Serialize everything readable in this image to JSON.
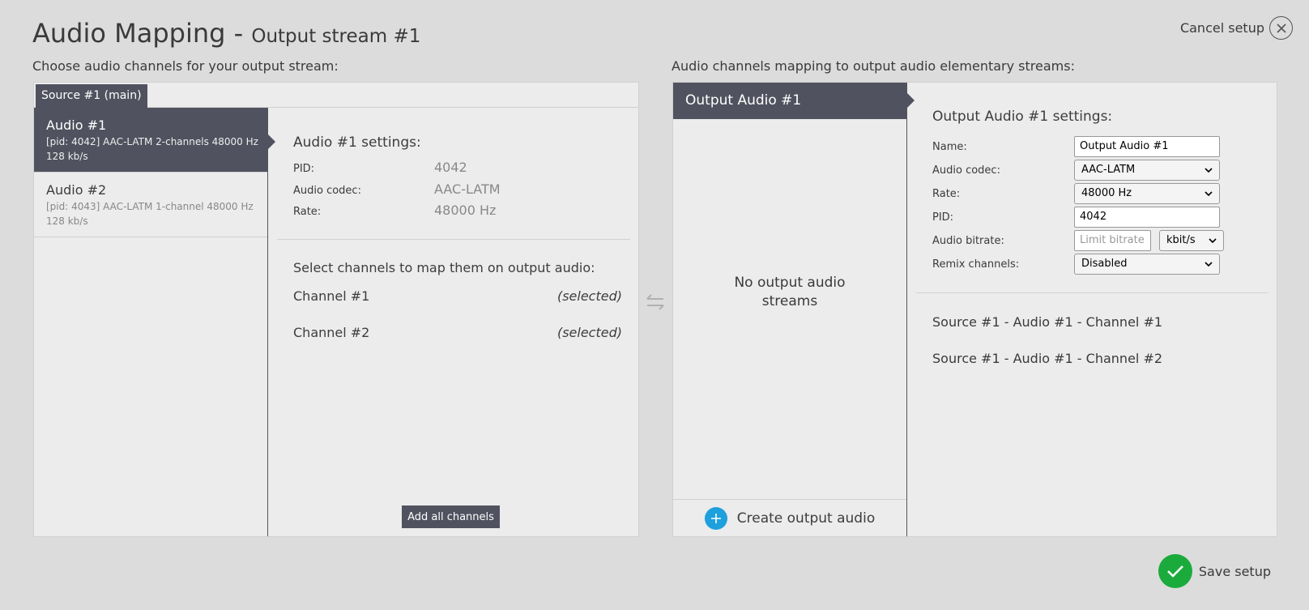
{
  "header": {
    "title": "Audio Mapping -",
    "subtitle": "Output stream #1",
    "cancel_label": "Cancel setup"
  },
  "left": {
    "caption": "Choose audio channels for your output stream:",
    "source_tab": "Source #1 (main)",
    "audio_items": [
      {
        "name": "Audio #1",
        "meta1": "[pid: 4042] AAC-LATM 2-channels 48000 Hz",
        "meta2": "128 kb/s",
        "active": true
      },
      {
        "name": "Audio #2",
        "meta1": "[pid: 4043] AAC-LATM 1-channel 48000 Hz",
        "meta2": "128 kb/s",
        "active": false
      }
    ],
    "settings": {
      "heading": "Audio #1 settings:",
      "rows": [
        {
          "key": "PID:",
          "value": "4042"
        },
        {
          "key": "Audio codec:",
          "value": "AAC-LATM"
        },
        {
          "key": "Rate:",
          "value": "48000 Hz"
        }
      ],
      "select_heading": "Select channels to map them on output audio:",
      "channels": [
        {
          "name": "Channel #1",
          "state": "(selected)"
        },
        {
          "name": "Channel #2",
          "state": "(selected)"
        }
      ],
      "add_all_label": "Add all channels"
    }
  },
  "right": {
    "caption": "Audio channels mapping to output audio elementary streams:",
    "output_tab": "Output Audio #1",
    "no_streams_line1": "No output audio",
    "no_streams_line2": "streams",
    "create_label": "Create output audio",
    "settings": {
      "heading": "Output Audio #1 settings:",
      "name_label": "Name:",
      "name_value": "Output Audio #1",
      "codec_label": "Audio codec:",
      "codec_value": "AAC-LATM",
      "rate_label": "Rate:",
      "rate_value": "48000 Hz",
      "pid_label": "PID:",
      "pid_value": "4042",
      "bitrate_label": "Audio bitrate:",
      "bitrate_placeholder": "Limit bitrate",
      "bitrate_unit": "kbit/s",
      "remix_label": "Remix channels:",
      "remix_value": "Disabled"
    },
    "mapped_channels": [
      "Source #1 - Audio #1 - Channel #1",
      "Source #1 - Audio #1 - Channel #2"
    ]
  },
  "footer": {
    "save_label": "Save setup"
  },
  "colors": {
    "accent_dark": "#50525f",
    "plus_blue": "#1ea0dc",
    "save_green": "#1aab3c"
  }
}
